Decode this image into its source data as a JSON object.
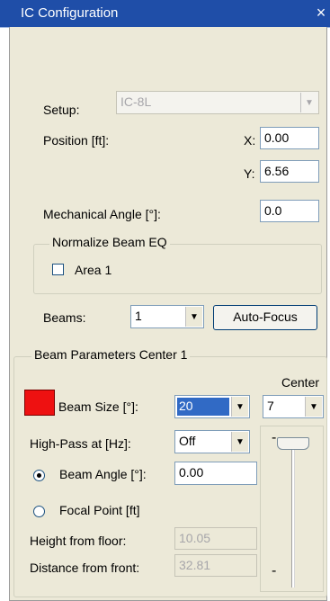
{
  "window": {
    "title": "IC Configuration",
    "close_glyph": "×"
  },
  "setup": {
    "label": "Setup:",
    "value": "IC-8L"
  },
  "position": {
    "label": "Position [ft]:",
    "x_label": "X:",
    "x_value": "0.00",
    "y_label": "Y:",
    "y_value": "6.56"
  },
  "mechanical_angle": {
    "label": "Mechanical Angle [°]:",
    "value": "0.0"
  },
  "normalize": {
    "group_label": "Normalize Beam EQ",
    "area_label": "Area 1",
    "area_checked": false
  },
  "beams": {
    "label": "Beams:",
    "value": "1",
    "autofocus_label": "Auto-Focus"
  },
  "beam_params": {
    "group_label": "Beam Parameters Center 1",
    "center_label": "Center",
    "center_value": "7",
    "beam_size_label": "Beam Size [°]:",
    "beam_size_value": "20",
    "beam_color": "#ee1111",
    "highpass_label": "High-Pass at [Hz]:",
    "highpass_value": "Off",
    "beam_angle_label": "Beam Angle [°]:",
    "beam_angle_value": "0.00",
    "beam_angle_selected": true,
    "focal_point_label": "Focal Point [ft]",
    "focal_point_selected": false,
    "height_label": "Height from floor:",
    "height_value": "10.05",
    "distance_label": "Distance from front:",
    "distance_value": "32.81",
    "slider_top_mark": "-",
    "slider_bottom_mark": "-"
  },
  "colors": {
    "titlebar": "#1f4ea8",
    "dialog_bg": "#ece9d8",
    "selection": "#316ac5"
  }
}
